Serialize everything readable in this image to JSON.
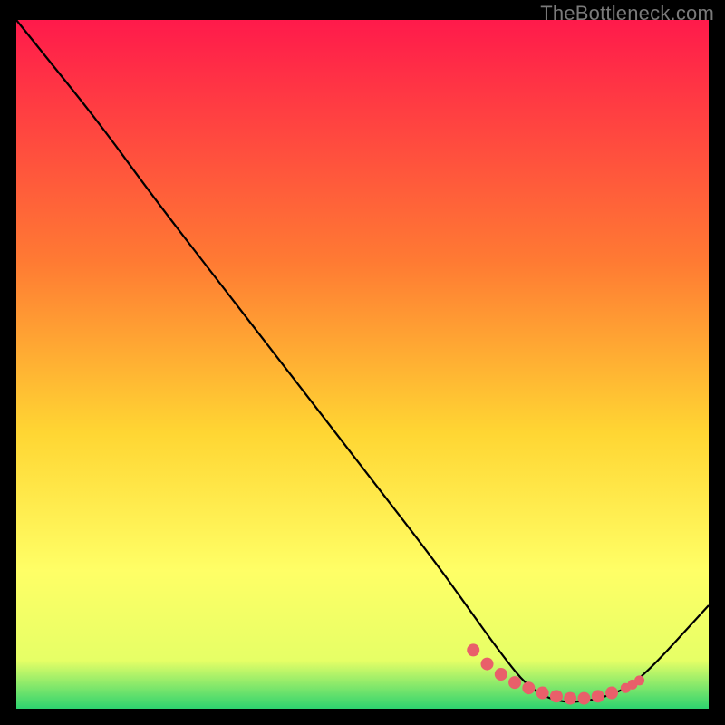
{
  "watermark": "TheBottleneck.com",
  "chart_data": {
    "type": "line",
    "title": "",
    "xlabel": "",
    "ylabel": "",
    "xlim": [
      0,
      100
    ],
    "ylim": [
      0,
      100
    ],
    "grid": false,
    "legend": false,
    "background": {
      "type": "vertical-gradient",
      "stops": [
        {
          "pos": 0,
          "color": "#ff1a4b"
        },
        {
          "pos": 35,
          "color": "#ff7a33"
        },
        {
          "pos": 60,
          "color": "#ffd633"
        },
        {
          "pos": 80,
          "color": "#ffff66"
        },
        {
          "pos": 93,
          "color": "#e6ff66"
        },
        {
          "pos": 100,
          "color": "#2dd36f"
        }
      ]
    },
    "series": [
      {
        "name": "bottleneck-curve",
        "color": "#000000",
        "x": [
          0,
          4,
          12,
          20,
          30,
          40,
          50,
          60,
          65,
          70,
          74,
          78,
          82,
          86,
          90,
          100
        ],
        "y": [
          100,
          95,
          85,
          74,
          61,
          48,
          35,
          22,
          15,
          8,
          3,
          1,
          1,
          2,
          4,
          15
        ]
      }
    ],
    "markers": {
      "name": "optimal-range-dots",
      "color": "#e95f6a",
      "x": [
        66,
        68,
        70,
        72,
        74,
        76,
        78,
        80,
        82,
        84,
        86,
        88,
        89,
        90
      ],
      "y": [
        8.5,
        6.5,
        5.0,
        3.8,
        3.0,
        2.3,
        1.8,
        1.5,
        1.5,
        1.8,
        2.3,
        3.0,
        3.5,
        4.1
      ]
    }
  }
}
